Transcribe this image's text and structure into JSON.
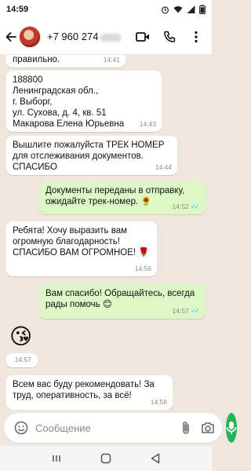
{
  "status_bar": {
    "time": "14:59",
    "battery": "84"
  },
  "header": {
    "phone": "+7 960 274"
  },
  "messages": [
    {
      "text": "правильно.",
      "time": "14:41"
    },
    {
      "text": "188800\nЛенинградская обл.,\nг. Выборг,\nул. Сухова, д. 4, кв. 51\nМакарова Елена Юрьевна",
      "time": "14:43"
    },
    {
      "text": "Вышлите пожалуйста ТРЕК НОМЕР\nдля отслеживания документов.\nСПАСИБО",
      "time": "14:44"
    },
    {
      "text": "Документы переданы в отправку,\nожидайте трек-номер. 🌻",
      "time": "14:52"
    },
    {
      "text": "Ребята! Хочу выразить вам\nогромную благодарность!\nСПАСИБО ВАМ ОГРОМНОЕ! 🌹",
      "time": "14:56"
    },
    {
      "text": "Вам спасибо! Обращайтесь, всегда\nрады помочь 😊",
      "time": "14:57"
    },
    {
      "text": "😘",
      "time": "14:57"
    },
    {
      "text": "Всем вас буду рекомендовать! За\nтруд, оперативность, за всё!",
      "time": "14:58"
    }
  ],
  "input": {
    "placeholder": "Сообщение"
  },
  "icons": {
    "back": "arrow-left-icon",
    "video": "video-camera-icon",
    "call": "phone-icon",
    "menu": "more-vertical-icon",
    "emoji": "smiley-icon",
    "attach": "paperclip-icon",
    "camera": "camera-icon",
    "mic": "microphone-icon"
  },
  "colors": {
    "incoming": "#ffffff",
    "outgoing": "#dcf8c6",
    "accent": "#25b35a",
    "read_ticks": "#4fc3f7",
    "chat_bg": "#efe7dd"
  }
}
